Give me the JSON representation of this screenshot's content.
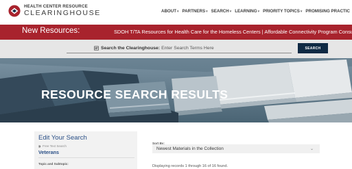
{
  "logo": {
    "line1": "HEALTH CENTER RESOURCE",
    "line2": "CLEARINGHOUSE"
  },
  "nav": {
    "items": [
      {
        "label": "ABOUT"
      },
      {
        "label": "PARTNERS"
      },
      {
        "label": "SEARCH"
      },
      {
        "label": "LEARNING"
      },
      {
        "label": "PRIORITY TOPICS"
      },
      {
        "label": "PROMISING PRACTIC"
      }
    ]
  },
  "banner": {
    "title": "New Resources:",
    "text": "SDOH T/TA Resources for Health Care for the Homeless Centers | Affordable Connectivity Program Consumer Outr"
  },
  "search": {
    "label": "Search the Clearinghouse:",
    "placeholder": "Enter Search Terms Here",
    "button_label": "SEARCH"
  },
  "hero": {
    "heading": "RESOURCE SEARCH RESULTS"
  },
  "sidebar": {
    "title": "Edit Your Search",
    "free_text_label": "Free Text Search",
    "query_value": "Veterans",
    "topic_label": "Topic and Subtopic:"
  },
  "sort": {
    "label": "Sort By:",
    "selected": "Newest Materials in the Collection"
  },
  "results": {
    "count_text": "Displaying records 1 through 16 of 16 found."
  },
  "colors": {
    "banner": "#a8232d",
    "search_button": "#0f2a44",
    "link_blue": "#2a4f86"
  }
}
